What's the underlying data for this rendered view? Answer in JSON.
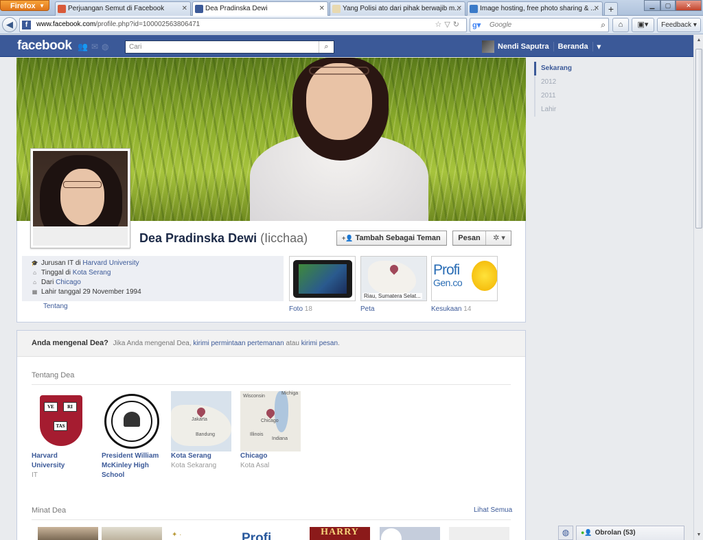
{
  "browser": {
    "app_button": "Firefox",
    "tabs": [
      {
        "title": "Perjuangan Semut di Facebook",
        "active": false
      },
      {
        "title": "Dea Pradinska Dewi",
        "active": true
      },
      {
        "title": "Yang Polisi ato dari pihak berwajib m...",
        "active": false
      },
      {
        "title": "Image hosting, free photo sharing & ...",
        "active": false
      }
    ],
    "new_tab": "+",
    "url_host": "www.facebook.com",
    "url_path": "/profile.php?id=100002563806471",
    "search_placeholder": "Google",
    "feedback_label": "Feedback"
  },
  "fb": {
    "logo": "facebook",
    "search_placeholder": "Cari",
    "user_name": "Nendi Saputra",
    "home_label": "Beranda"
  },
  "timeline_nav": [
    "Sekarang",
    "2012",
    "2011",
    "Lahir"
  ],
  "profile": {
    "name": "Dea Pradinska Dewi",
    "alt_name": "(Iicchaa)",
    "add_friend_label": "Tambah Sebagai Teman",
    "message_label": "Pesan",
    "info": {
      "study_prefix": "Jurusan IT di ",
      "study_link": "Harvard University",
      "lives_prefix": "Tinggal di ",
      "lives_link": "Kota Serang",
      "from_prefix": "Dari ",
      "from_link": "Chicago",
      "born": "Lahir tanggal 29 November 1994"
    },
    "about_link": "Tentang",
    "tiles": {
      "photos_label": "Foto",
      "photos_count": "18",
      "map_label": "Peta",
      "map_caption": "Riau, Sumatera Selat...",
      "likes_label": "Kesukaan",
      "likes_count": "14",
      "likes_logo_1": "Profi",
      "likes_logo_2": "Gen.co"
    }
  },
  "know": {
    "question": "Anda mengenal Dea?",
    "text_1": "Jika Anda mengenal Dea, ",
    "link_1": "kirimi permintaan pertemanan",
    "text_2": " atau ",
    "link_2": "kirimi pesan",
    "text_3": "."
  },
  "about_section": {
    "title": "Tentang Dea",
    "items": [
      {
        "title": "Harvard University",
        "sub": "IT"
      },
      {
        "title": "President William McKinley High School",
        "sub": ""
      },
      {
        "title": "Kota Serang",
        "sub": "Kota Sekarang"
      },
      {
        "title": "Chicago",
        "sub": "Kota Asal"
      }
    ],
    "harvard_shield": [
      "VE",
      "RI",
      "TAS"
    ],
    "map1_labels": [
      "Jakarta",
      "Bandung"
    ],
    "map2_labels": [
      "Wisconsin",
      "Michiga",
      "Chicago",
      "Illinois",
      "Indiana"
    ]
  },
  "interests": {
    "title": "Minat Dea",
    "see_all": "Lihat Semua",
    "thumb_texts": [
      "HARRY",
      "Profi"
    ]
  },
  "chat": {
    "label": "Obrolan (53)"
  }
}
